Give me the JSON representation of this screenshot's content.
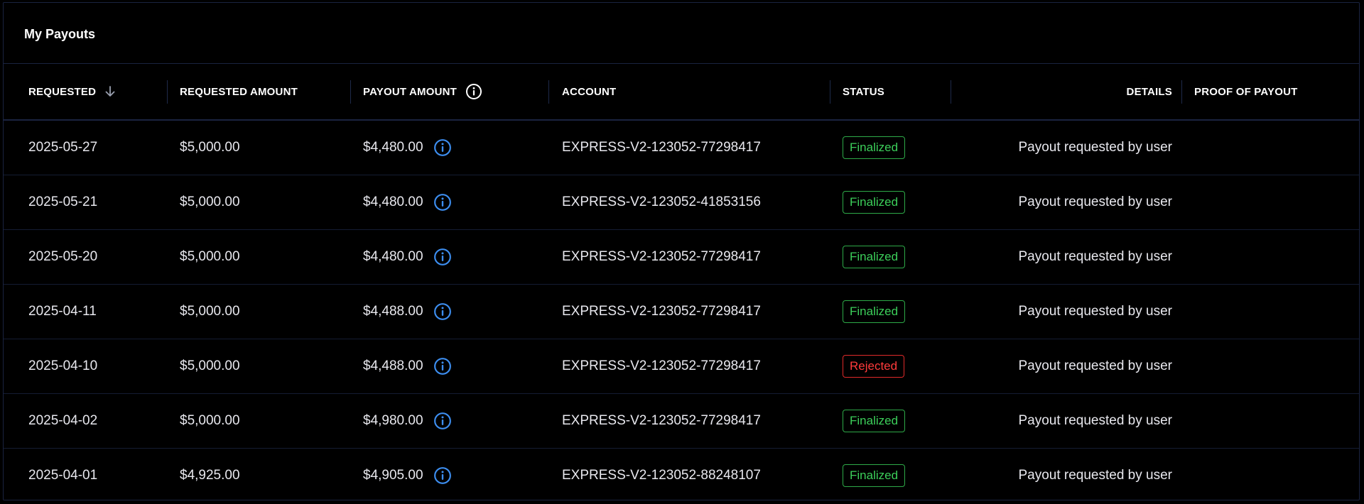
{
  "panel": {
    "title": "My Payouts"
  },
  "columns": {
    "requested": "REQUESTED",
    "requested_amount": "REQUESTED AMOUNT",
    "payout_amount": "PAYOUT AMOUNT",
    "account": "ACCOUNT",
    "status": "STATUS",
    "details": "DETAILS",
    "proof": "PROOF OF PAYOUT"
  },
  "icons": {
    "sort": "arrow-down-icon",
    "header_info": "info-icon",
    "row_info": "info-icon"
  },
  "colors": {
    "background": "#000000",
    "border": "#1a2340",
    "finalized": "#3ccf5a",
    "rejected": "#ff3b3b",
    "info_icon": "#3d8ef0"
  },
  "rows": [
    {
      "date": "2025-05-27",
      "requested_amount": "$5,000.00",
      "payout_amount": "$4,480.00",
      "account": "EXPRESS-V2-123052-77298417",
      "status": "Finalized",
      "status_type": "finalized",
      "details": "Payout requested by user"
    },
    {
      "date": "2025-05-21",
      "requested_amount": "$5,000.00",
      "payout_amount": "$4,480.00",
      "account": "EXPRESS-V2-123052-41853156",
      "status": "Finalized",
      "status_type": "finalized",
      "details": "Payout requested by user"
    },
    {
      "date": "2025-05-20",
      "requested_amount": "$5,000.00",
      "payout_amount": "$4,480.00",
      "account": "EXPRESS-V2-123052-77298417",
      "status": "Finalized",
      "status_type": "finalized",
      "details": "Payout requested by user"
    },
    {
      "date": "2025-04-11",
      "requested_amount": "$5,000.00",
      "payout_amount": "$4,488.00",
      "account": "EXPRESS-V2-123052-77298417",
      "status": "Finalized",
      "status_type": "finalized",
      "details": "Payout requested by user"
    },
    {
      "date": "2025-04-10",
      "requested_amount": "$5,000.00",
      "payout_amount": "$4,488.00",
      "account": "EXPRESS-V2-123052-77298417",
      "status": "Rejected",
      "status_type": "rejected",
      "details": "Payout requested by user"
    },
    {
      "date": "2025-04-02",
      "requested_amount": "$5,000.00",
      "payout_amount": "$4,980.00",
      "account": "EXPRESS-V2-123052-77298417",
      "status": "Finalized",
      "status_type": "finalized",
      "details": "Payout requested by user"
    },
    {
      "date": "2025-04-01",
      "requested_amount": "$4,925.00",
      "payout_amount": "$4,905.00",
      "account": "EXPRESS-V2-123052-88248107",
      "status": "Finalized",
      "status_type": "finalized",
      "details": "Payout requested by user"
    }
  ]
}
